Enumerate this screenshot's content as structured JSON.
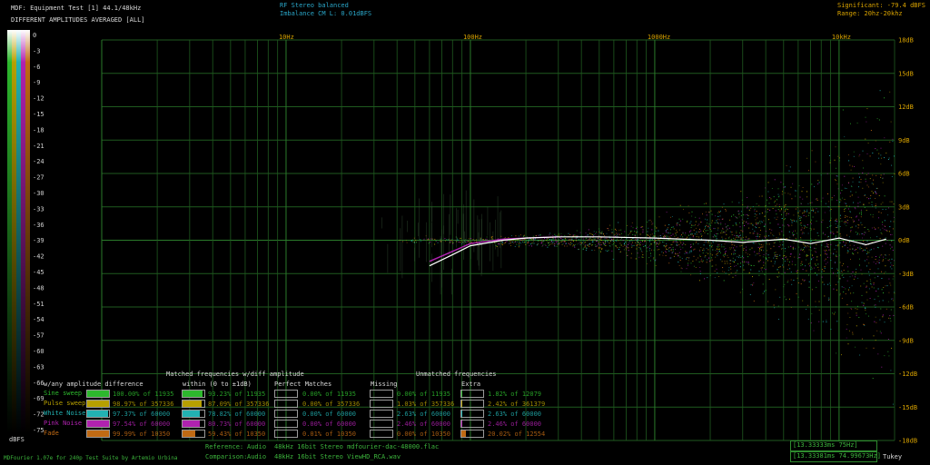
{
  "header": {
    "title_line": "MDF: Equipment Test [1] 44.1/48kHz",
    "subtitle_line": "DIFFERENT AMPLITUDES AVERAGED [ALL]",
    "center_line1": "RF Stereo balanced",
    "center_line2": "Imbalance CM L: 0.01dBFS",
    "significant": "Significant: -79.4 dBFS",
    "range": "Range: 20hz-20khz"
  },
  "colors": {
    "sine_sweep": "#2db82d",
    "pulse_sweep": "#b7a000",
    "white_noise": "#22b2b2",
    "pink_noise": "#b022b0",
    "fade": "#c06a14",
    "grid": "#1f5a1f",
    "axis_text": "#d9a300",
    "cyan_text": "#2aa6c8"
  },
  "chart_data": {
    "type": "scatter",
    "x_scale": "log",
    "xlim": [
      1,
      20000
    ],
    "ylim": [
      -18,
      18
    ],
    "x_tick_labels": [
      "10Hz",
      "100Hz",
      "1000Hz",
      "10kHz"
    ],
    "y_tick_labels": [
      "18dB",
      "15dB",
      "12dB",
      "9dB",
      "6dB",
      "3dB",
      "0dB",
      "-3dB",
      "-6dB",
      "-9dB",
      "-12dB",
      "-15dB",
      "-18dB"
    ],
    "colorbar_labels": [
      "0",
      "-3",
      "-6",
      "-9",
      "-12",
      "-15",
      "-18",
      "-21",
      "-24",
      "-27",
      "-30",
      "-33",
      "-36",
      "-39",
      "-42",
      "-45",
      "-48",
      "-51",
      "-54",
      "-57",
      "-60",
      "-63",
      "-66",
      "-69",
      "-72",
      "-75"
    ],
    "colorbar_unit": "dBFS",
    "grid": true,
    "average_line": {
      "x": [
        60,
        80,
        100,
        150,
        200,
        300,
        500,
        1000,
        2000,
        3000,
        5000,
        7000,
        10000,
        14000,
        18000
      ],
      "y": [
        -2.3,
        -1.3,
        -0.5,
        0.0,
        0.2,
        0.3,
        0.3,
        0.2,
        0.0,
        -0.2,
        0.1,
        -0.3,
        0.2,
        -0.4,
        0.1
      ]
    },
    "pink_line": {
      "x": [
        60,
        80,
        100,
        150,
        200,
        300
      ],
      "y": [
        -1.9,
        -1.0,
        -0.3,
        0.1,
        0.2,
        0.3
      ]
    }
  },
  "legend": {
    "section1_title": "w/any amplitude difference",
    "matched_title": "Matched frequencies w/diff amplitude",
    "within_title": "within (0 to ±1dB)",
    "perfect_title": "Perfect Matches",
    "missing_title": "Missing",
    "unmatched_title": "Unmatched frequencies",
    "extra_title": "Extra",
    "rows": [
      {
        "name": "Sine sweep",
        "color": "#2db82d",
        "any": "100.00% of 11935",
        "any_frac": 1.0,
        "within": "93.23% of 11935",
        "within_frac": 0.93,
        "perfect": "0.00% of 11935",
        "missing": "0.00% of 11935",
        "extra": "1.82% of 12079",
        "extra_frac": 0.02
      },
      {
        "name": "Pulse sweep",
        "color": "#b7a000",
        "any": "98.97% of 357336",
        "any_frac": 0.99,
        "within": "87.09% of 357336",
        "within_frac": 0.87,
        "perfect": "0.00% of 357336",
        "missing": "1.03% of 357336",
        "extra": "2.42% of 361379",
        "extra_frac": 0.02
      },
      {
        "name": "White Noise",
        "color": "#22b2b2",
        "any": "97.37% of 60000",
        "any_frac": 0.97,
        "within": "78.82% of 60000",
        "within_frac": 0.79,
        "perfect": "0.00% of 60000",
        "missing": "2.63% of 60000",
        "extra": "2.63% of 60000",
        "extra_frac": 0.03
      },
      {
        "name": "Pink Noise",
        "color": "#b022b0",
        "any": "97.54% of 60000",
        "any_frac": 0.98,
        "within": "80.73% of 60000",
        "within_frac": 0.81,
        "perfect": "0.00% of 60000",
        "missing": "2.46% of 60000",
        "extra": "2.46% of 60000",
        "extra_frac": 0.02
      },
      {
        "name": "Fade",
        "color": "#c06a14",
        "any": "99.99% of 10350",
        "any_frac": 1.0,
        "within": "59.43% of 10350",
        "within_frac": 0.59,
        "perfect": "0.01% of 10350",
        "missing": "0.00% of 10350",
        "extra": "20.02% of 12554",
        "extra_frac": 0.2
      }
    ]
  },
  "footer": {
    "credit": "MDFourier 1.07e for 240p Test Suite by Artemio Urbina",
    "reference_label": "Reference:",
    "reference_kind": "Audio",
    "reference_value": "48kHz 16bit Stereo mdfourier-dac-48000.flac",
    "comparison_label": "Comparison:",
    "comparison_kind": "Audio",
    "comparison_value": "48kHz 16bit Stereo ViewHD_RCA.wav",
    "window1": "[13.33333ms 75Hz]",
    "window2": "[13.33381ms 74.99673Hz]",
    "window_type": "Tukey"
  }
}
